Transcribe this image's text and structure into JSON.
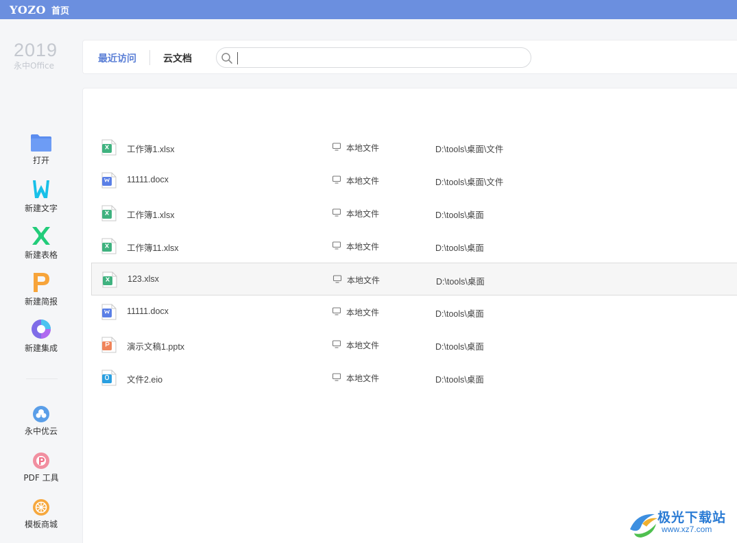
{
  "titlebar": {
    "brand": "YOZO",
    "tab": "首页"
  },
  "logo": {
    "year": "2019",
    "product": "永中Office"
  },
  "sidebar": {
    "actions": [
      {
        "label": "打开",
        "icon": "folder-icon"
      },
      {
        "label": "新建文字",
        "icon": "word-w-icon"
      },
      {
        "label": "新建表格",
        "icon": "spreadsheet-x-icon"
      },
      {
        "label": "新建简报",
        "icon": "presentation-p-icon"
      },
      {
        "label": "新建集成",
        "icon": "integrated-o-icon"
      }
    ],
    "tools": [
      {
        "label": "永中优云",
        "icon": "cloud-icon"
      },
      {
        "label": "PDF 工具",
        "icon": "pdf-icon"
      },
      {
        "label": "模板商城",
        "icon": "template-store-icon"
      }
    ]
  },
  "header": {
    "tabs": [
      {
        "label": "最近访问",
        "active": true
      },
      {
        "label": "云文档",
        "active": false
      }
    ],
    "search": {
      "value": "",
      "placeholder": ""
    }
  },
  "files": [
    {
      "name": "工作簿1.xlsx",
      "type": "xlsx",
      "location": "本地文件",
      "path": "D:\\tools\\桌面\\文件"
    },
    {
      "name": "11111.docx",
      "type": "docx",
      "location": "本地文件",
      "path": "D:\\tools\\桌面\\文件"
    },
    {
      "name": "工作簿1.xlsx",
      "type": "xlsx",
      "location": "本地文件",
      "path": "D:\\tools\\桌面"
    },
    {
      "name": "工作簿11.xlsx",
      "type": "xlsx",
      "location": "本地文件",
      "path": "D:\\tools\\桌面"
    },
    {
      "name": "123.xlsx",
      "type": "xlsx",
      "location": "本地文件",
      "path": "D:\\tools\\桌面",
      "selected": true
    },
    {
      "name": "11111.docx",
      "type": "docx",
      "location": "本地文件",
      "path": "D:\\tools\\桌面"
    },
    {
      "name": "演示文稿1.pptx",
      "type": "pptx",
      "location": "本地文件",
      "path": "D:\\tools\\桌面"
    },
    {
      "name": "文件2.eio",
      "type": "eio",
      "location": "本地文件",
      "path": "D:\\tools\\桌面"
    }
  ],
  "watermark": {
    "name": "极光下载站",
    "url": "www.xz7.com"
  },
  "colors": {
    "titlebar": "#6b8fdf",
    "accent": "#5b7fd6",
    "xlsx": "#3fb27f",
    "docx": "#5a7fe6",
    "pptx": "#f0845a",
    "eio": "#2a9fe0"
  }
}
